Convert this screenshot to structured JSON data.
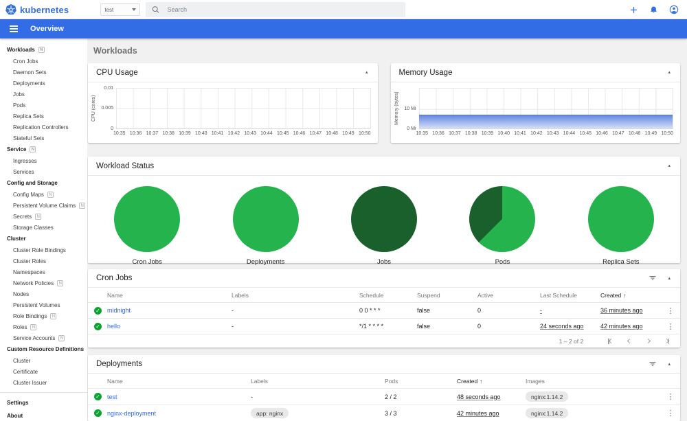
{
  "colors": {
    "brand_blue": "#326de6",
    "pie_green": "#24b34c",
    "pie_dark_green": "#19602c",
    "success_green": "#0aa32f",
    "background": "#f1f1f1",
    "memory_area_line": "#4a74dc"
  },
  "icons": {
    "ns_badge": "N",
    "collapse_caret": "▴",
    "sort_up": "↑",
    "menu_dots": "⋮",
    "check": "✓"
  },
  "topbar": {
    "logo_text": "kubernetes",
    "namespace_value": "test",
    "search_placeholder": "Search"
  },
  "appbar": {
    "title": "Overview"
  },
  "page": {
    "title": "Workloads"
  },
  "sidebar": {
    "groups": [
      {
        "header": "Workloads",
        "badge": true,
        "items": [
          {
            "label": "Cron Jobs"
          },
          {
            "label": "Daemon Sets"
          },
          {
            "label": "Deployments"
          },
          {
            "label": "Jobs"
          },
          {
            "label": "Pods"
          },
          {
            "label": "Replica Sets"
          },
          {
            "label": "Replication Controllers"
          },
          {
            "label": "Stateful Sets"
          }
        ]
      },
      {
        "header": "Service",
        "badge": true,
        "items": [
          {
            "label": "Ingresses"
          },
          {
            "label": "Services"
          }
        ]
      },
      {
        "header": "Config and Storage",
        "badge": false,
        "items": [
          {
            "label": "Config Maps",
            "badge": true
          },
          {
            "label": "Persistent Volume Claims",
            "badge": true
          },
          {
            "label": "Secrets",
            "badge": true
          },
          {
            "label": "Storage Classes"
          }
        ]
      },
      {
        "header": "Cluster",
        "badge": false,
        "items": [
          {
            "label": "Cluster Role Bindings"
          },
          {
            "label": "Cluster Roles"
          },
          {
            "label": "Namespaces"
          },
          {
            "label": "Network Policies",
            "badge": true
          },
          {
            "label": "Nodes"
          },
          {
            "label": "Persistent Volumes"
          },
          {
            "label": "Role Bindings",
            "badge": true
          },
          {
            "label": "Roles",
            "badge": true
          },
          {
            "label": "Service Accounts",
            "badge": true
          }
        ]
      },
      {
        "header": "Custom Resource Definitions",
        "badge": false,
        "items": [
          {
            "label": "Cluster"
          },
          {
            "label": "Certificate"
          },
          {
            "label": "Cluster Issuer"
          }
        ]
      }
    ],
    "footer_items": [
      {
        "label": "Settings"
      },
      {
        "label": "About"
      }
    ]
  },
  "charts": {
    "x_ticks": [
      "10:35",
      "10:36",
      "10:37",
      "10:38",
      "10:39",
      "10:40",
      "10:41",
      "10:42",
      "10:43",
      "10:44",
      "10:45",
      "10:46",
      "10:47",
      "10:48",
      "10:49",
      "10:50"
    ],
    "cpu": {
      "title": "CPU Usage",
      "ylabel": "CPU (cores)",
      "yticks": [
        "0.01",
        "0.005",
        "0"
      ]
    },
    "memory": {
      "title": "Memory Usage",
      "ylabel": "Memory (bytes)",
      "yticks": [
        "10 Mi",
        "0 Mi"
      ]
    }
  },
  "workload_status": {
    "title": "Workload Status",
    "pies": [
      {
        "label": "Cron Jobs"
      },
      {
        "label": "Deployments"
      },
      {
        "label": "Jobs"
      },
      {
        "label": "Pods"
      },
      {
        "label": "Replica Sets"
      }
    ]
  },
  "cron_jobs": {
    "title": "Cron Jobs",
    "columns": {
      "name": "Name",
      "labels": "Labels",
      "schedule": "Schedule",
      "suspend": "Suspend",
      "active": "Active",
      "last_schedule": "Last Schedule",
      "created": "Created"
    },
    "rows": [
      {
        "name": "midnight",
        "labels": "-",
        "schedule": "0 0 * * *",
        "suspend": "false",
        "active": "0",
        "last_schedule": "-",
        "created": "36 minutes ago"
      },
      {
        "name": "hello",
        "labels": "-",
        "schedule": "*/1 * * * *",
        "suspend": "false",
        "active": "0",
        "last_schedule": "24 seconds ago",
        "created": "42 minutes ago"
      }
    ],
    "pagination": {
      "range_text": "1 – 2 of 2"
    }
  },
  "deployments": {
    "title": "Deployments",
    "columns": {
      "name": "Name",
      "labels": "Labels",
      "pods": "Pods",
      "created": "Created",
      "images": "Images"
    },
    "rows": [
      {
        "name": "test",
        "labels": "-",
        "pods": "2 / 2",
        "created": "48 seconds ago",
        "images": "nginx:1.14.2"
      },
      {
        "name": "nginx-deployment",
        "labels": "app: nginx",
        "pods": "3 / 3",
        "created": "42 minutes ago",
        "images": "nginx:1.14.2"
      }
    ]
  },
  "chart_data": [
    {
      "type": "line",
      "title": "CPU Usage",
      "ylabel": "CPU (cores)",
      "x": [
        "10:35",
        "10:36",
        "10:37",
        "10:38",
        "10:39",
        "10:40",
        "10:41",
        "10:42",
        "10:43",
        "10:44",
        "10:45",
        "10:46",
        "10:47",
        "10:48",
        "10:49",
        "10:50"
      ],
      "series": [],
      "ylim": [
        0,
        0.01
      ],
      "grid": true,
      "note": "no data series visible"
    },
    {
      "type": "area",
      "title": "Memory Usage",
      "ylabel": "Memory (bytes)",
      "x": [
        "10:35",
        "10:36",
        "10:37",
        "10:38",
        "10:39",
        "10:40",
        "10:41",
        "10:42",
        "10:43",
        "10:44",
        "10:45",
        "10:46",
        "10:47",
        "10:48",
        "10:49",
        "10:50"
      ],
      "series": [
        {
          "name": "memory",
          "values_Mi": [
            8,
            8,
            8,
            8,
            8,
            8,
            8,
            8,
            8,
            8,
            8,
            8,
            8,
            8,
            8,
            8
          ]
        }
      ],
      "ylim_Mi": [
        0,
        21
      ],
      "grid": true
    },
    {
      "type": "pie",
      "title": "Cron Jobs",
      "slices": [
        {
          "label": "ready",
          "fraction": 1.0,
          "color": "#24b34c"
        }
      ]
    },
    {
      "type": "pie",
      "title": "Deployments",
      "slices": [
        {
          "label": "ready",
          "fraction": 1.0,
          "color": "#24b34c"
        }
      ]
    },
    {
      "type": "pie",
      "title": "Jobs",
      "slices": [
        {
          "label": "succeeded",
          "fraction": 1.0,
          "color": "#19602c"
        }
      ]
    },
    {
      "type": "pie",
      "title": "Pods",
      "slices": [
        {
          "label": "running",
          "fraction": 0.625,
          "color": "#24b34c"
        },
        {
          "label": "succeeded",
          "fraction": 0.375,
          "color": "#19602c"
        }
      ]
    },
    {
      "type": "pie",
      "title": "Replica Sets",
      "slices": [
        {
          "label": "ready",
          "fraction": 1.0,
          "color": "#24b34c"
        }
      ]
    }
  ]
}
